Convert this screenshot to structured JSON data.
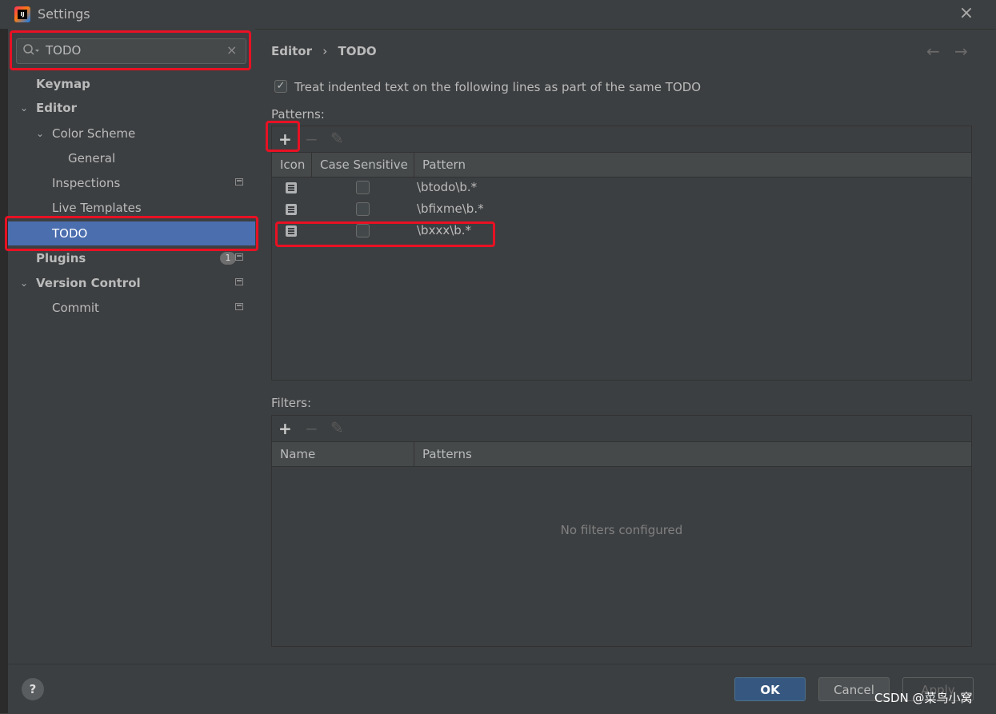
{
  "window": {
    "title": "Settings",
    "app_icon_text": "IJ"
  },
  "search": {
    "value": "TODO",
    "clear": "×"
  },
  "tree": {
    "keymap": "Keymap",
    "editor": "Editor",
    "color_scheme": "Color Scheme",
    "general": "General",
    "inspections": "Inspections",
    "live_templates": "Live Templates",
    "todo": "TODO",
    "plugins": "Plugins",
    "plugins_badge": "1",
    "version_control": "Version Control",
    "commit": "Commit"
  },
  "main": {
    "breadcrumb_parent": "Editor",
    "breadcrumb_sep": "›",
    "breadcrumb_current": "TODO",
    "checkbox_label": "Treat indented text on the following lines as part of the same TODO",
    "patterns_label": "Patterns:",
    "patterns_columns": [
      "Icon",
      "Case Sensitive",
      "Pattern"
    ],
    "patterns_rows": [
      {
        "pattern": "\\btodo\\b.*",
        "case_sensitive": false
      },
      {
        "pattern": "\\bfixme\\b.*",
        "case_sensitive": false
      },
      {
        "pattern": "\\bxxx\\b.*",
        "case_sensitive": false
      }
    ],
    "filters_label": "Filters:",
    "filters_columns": [
      "Name",
      "Patterns"
    ],
    "filters_empty": "No filters configured"
  },
  "toolbar": {
    "add": "+",
    "remove": "−",
    "edit": "✎"
  },
  "footer": {
    "help": "?",
    "ok": "OK",
    "cancel": "Cancel",
    "apply": "Apply"
  },
  "watermark": "CSDN @菜鸟小窝",
  "colors": {
    "selection": "#4b6eaf",
    "annotation": "#e81123",
    "ok_button": "#365880"
  }
}
